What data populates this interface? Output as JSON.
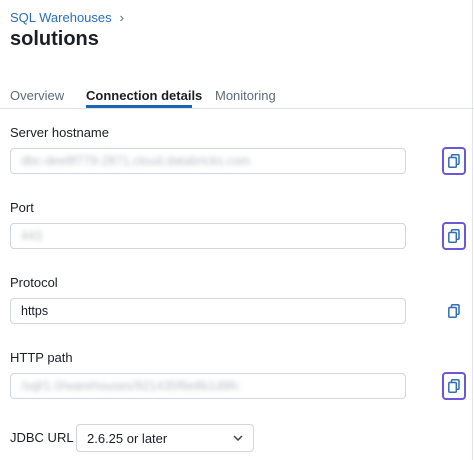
{
  "breadcrumb": {
    "parent": "SQL Warehouses",
    "separator": "›"
  },
  "page": {
    "title": "solutions"
  },
  "tabs": [
    {
      "label": "Overview",
      "active": false
    },
    {
      "label": "Connection details",
      "active": true
    },
    {
      "label": "Monitoring",
      "active": false
    }
  ],
  "fields": {
    "server_hostname": {
      "label": "Server hostname",
      "value": "dbc-dee8f779-2871.cloud.databricks.com"
    },
    "port": {
      "label": "Port",
      "value": "443"
    },
    "protocol": {
      "label": "Protocol",
      "value": "https"
    },
    "http_path": {
      "label": "HTTP path",
      "value": "/sql/1.0/warehouses/921435f6e8b1d9fc"
    }
  },
  "jdbc": {
    "label": "JDBC URL",
    "selected": "2.6.25 or later"
  },
  "colors": {
    "accent": "#1b65b6",
    "focus_ring": "#6a58d7",
    "link": "#2a6ebd"
  },
  "icons": {
    "copy": "copy-icon",
    "chevron": "chevron-down-icon"
  }
}
